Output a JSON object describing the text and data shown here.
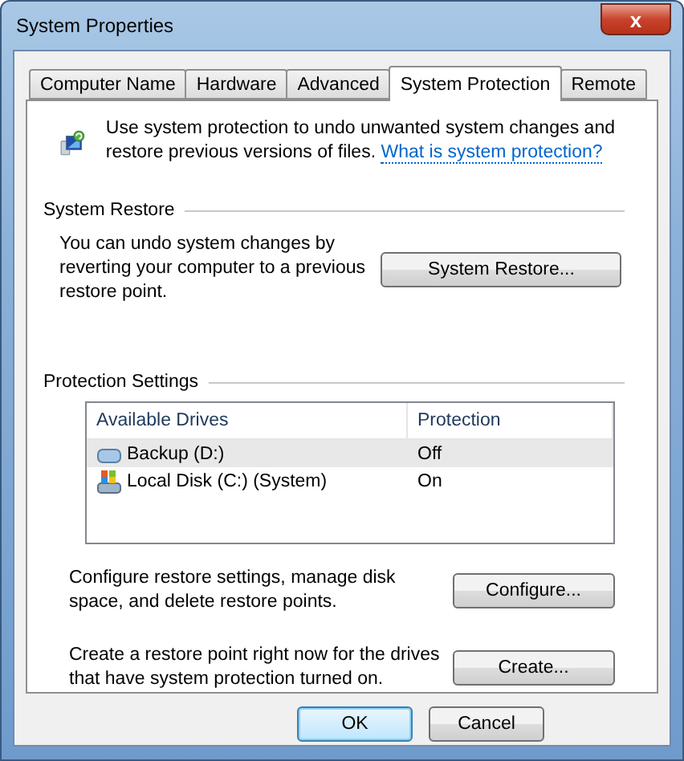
{
  "window": {
    "title": "System Properties",
    "close": "x"
  },
  "tabs": [
    {
      "label": "Computer Name",
      "selected": false
    },
    {
      "label": "Hardware",
      "selected": false
    },
    {
      "label": "Advanced",
      "selected": false
    },
    {
      "label": "System Protection",
      "selected": true
    },
    {
      "label": "Remote",
      "selected": false
    }
  ],
  "intro": {
    "text": "Use system protection to undo unwanted system changes and restore previous versions of files.",
    "link": "What is system protection?"
  },
  "system_restore": {
    "heading": "System Restore",
    "text": "You can undo system changes by reverting your computer to a previous restore point.",
    "button": "System Restore..."
  },
  "protection_settings": {
    "heading": "Protection Settings",
    "columns": [
      "Available Drives",
      "Protection"
    ],
    "rows": [
      {
        "drive": "Backup (D:)",
        "protection": "Off",
        "kind": "backup",
        "selected": true
      },
      {
        "drive": "Local Disk (C:) (System)",
        "protection": "On",
        "kind": "system",
        "selected": false
      }
    ],
    "actions": [
      {
        "text": "Configure restore settings, manage disk space, and delete restore points.",
        "button": "Configure..."
      },
      {
        "text": "Create a restore point right now for the drives that have system protection turned on.",
        "button": "Create..."
      }
    ]
  },
  "buttons": [
    {
      "label": "OK",
      "default": true
    },
    {
      "label": "Cancel",
      "default": false
    }
  ]
}
